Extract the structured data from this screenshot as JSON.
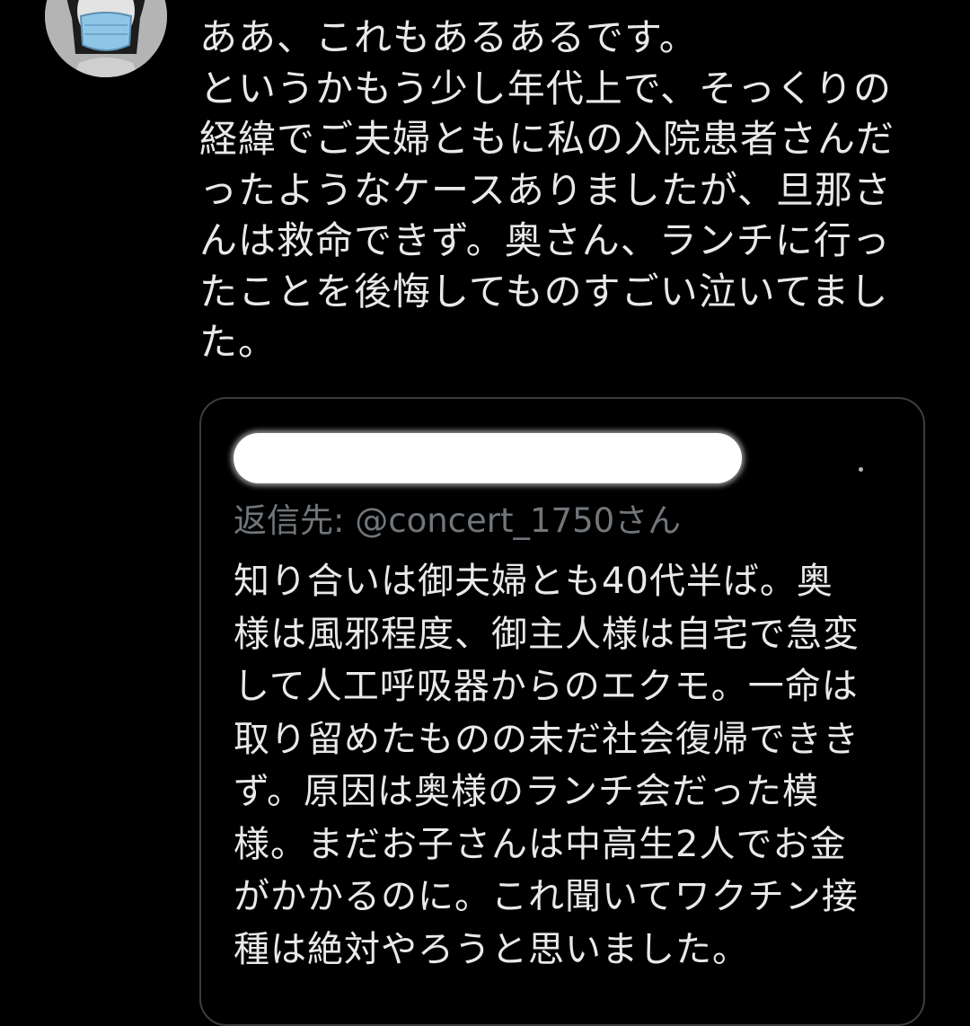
{
  "tweet": {
    "lines": [
      "ああ、これもあるあるです。",
      "というかもう少し年代上で、そっくりの",
      "経緯でご夫婦ともに私の入院患者さんだ",
      "ったようなケースありましたが、旦那さ",
      "んは救命できず。奥さん、ランチに行っ",
      "たことを後悔してものすごい泣いてまし",
      "た。"
    ]
  },
  "quoted_tweet": {
    "reply_to": "返信先: @concert_1750さん",
    "lines": [
      "知り合いは御夫婦とも40代半ば。奥",
      "様は風邪程度、御主人様は自宅で急変",
      "して人工呼吸器からのエクモ。一命は",
      "取り留めたものの未だ社会復帰できき",
      "ず。原因は奥様のランチ会だった模",
      "様。まだお子さんは中高生2人でお金",
      "がかかるのに。これ聞いてワクチン接",
      "種は絶対やろうと思いました。"
    ]
  },
  "icons": {
    "avatar": "masked-person-avatar"
  },
  "colors": {
    "background": "#000000",
    "text": "#e7e9ea",
    "secondary_text": "#71767b",
    "card_border": "#3a3d41",
    "mask": "#8fc6e8"
  }
}
